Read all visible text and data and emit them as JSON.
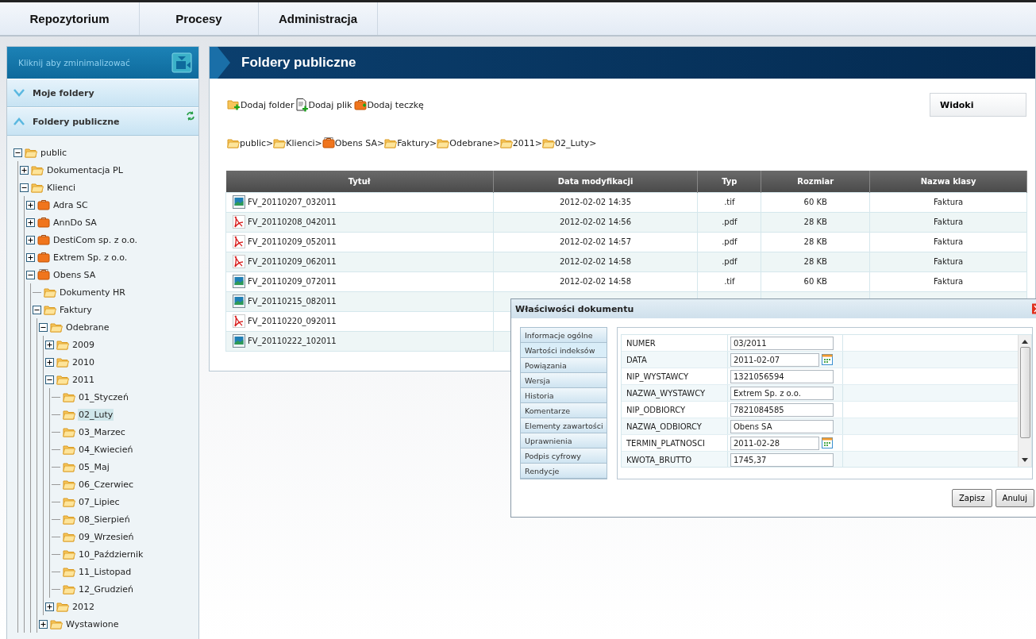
{
  "nav": {
    "items": [
      {
        "label": "Repozytorium",
        "selected": false
      },
      {
        "label": "Procesy",
        "selected": false
      },
      {
        "label": "Administracja",
        "selected": false
      }
    ]
  },
  "sidebar": {
    "minimize_label": "Kliknij aby zminimalizować",
    "sections": [
      {
        "label": "Moje foldery",
        "expanded": false
      },
      {
        "label": "Foldery publiczne",
        "expanded": true
      }
    ],
    "tree": [
      {
        "label": "public",
        "kind": "folder",
        "expanded": true,
        "selected": false,
        "children": [
          {
            "label": "Dokumentacja PL",
            "kind": "folder",
            "expanded": false,
            "selected": false
          },
          {
            "label": "Klienci",
            "kind": "folder",
            "expanded": true,
            "selected": false,
            "children": [
              {
                "label": "Adra SC",
                "kind": "case",
                "expanded": false,
                "selected": false
              },
              {
                "label": "AnnDo SA",
                "kind": "case",
                "expanded": false,
                "selected": false
              },
              {
                "label": "DestiCom sp. z o.o.",
                "kind": "case",
                "expanded": false,
                "selected": false
              },
              {
                "label": "Extrem Sp. z o.o.",
                "kind": "case",
                "expanded": false,
                "selected": false
              },
              {
                "label": "Obens SA",
                "kind": "opencase",
                "expanded": true,
                "selected": false,
                "children": [
                  {
                    "label": "Dokumenty HR",
                    "kind": "folder",
                    "selected": false
                  },
                  {
                    "label": "Faktury",
                    "kind": "folder",
                    "expanded": true,
                    "selected": false,
                    "children": [
                      {
                        "label": "Odebrane",
                        "kind": "folder",
                        "expanded": true,
                        "selected": false,
                        "children": [
                          {
                            "label": "2009",
                            "kind": "folder",
                            "expanded": false,
                            "selected": false
                          },
                          {
                            "label": "2010",
                            "kind": "folder",
                            "expanded": false,
                            "selected": false
                          },
                          {
                            "label": "2011",
                            "kind": "folder",
                            "expanded": true,
                            "selected": false,
                            "children": [
                              {
                                "label": "01_Styczeń",
                                "kind": "folder",
                                "selected": false
                              },
                              {
                                "label": "02_Luty",
                                "kind": "folder",
                                "selected": true
                              },
                              {
                                "label": "03_Marzec",
                                "kind": "folder",
                                "selected": false
                              },
                              {
                                "label": "04_Kwiecień",
                                "kind": "folder",
                                "selected": false
                              },
                              {
                                "label": "05_Maj",
                                "kind": "folder",
                                "selected": false
                              },
                              {
                                "label": "06_Czerwiec",
                                "kind": "folder",
                                "selected": false
                              },
                              {
                                "label": "07_Lipiec",
                                "kind": "folder",
                                "selected": false
                              },
                              {
                                "label": "08_Sierpień",
                                "kind": "folder",
                                "selected": false
                              },
                              {
                                "label": "09_Wrzesień",
                                "kind": "folder",
                                "selected": false
                              },
                              {
                                "label": "10_Październik",
                                "kind": "folder",
                                "selected": false
                              },
                              {
                                "label": "11_Listopad",
                                "kind": "folder",
                                "selected": false
                              },
                              {
                                "label": "12_Grudzień",
                                "kind": "folder",
                                "selected": false
                              }
                            ]
                          },
                          {
                            "label": "2012",
                            "kind": "folder",
                            "expanded": false,
                            "selected": false
                          }
                        ]
                      },
                      {
                        "label": "Wystawione",
                        "kind": "folder",
                        "expanded": false,
                        "selected": false
                      }
                    ]
                  }
                ]
              }
            ]
          }
        ]
      }
    ]
  },
  "main": {
    "title": "Foldery publiczne",
    "actions": [
      {
        "label": "Dodaj folder",
        "kind": "folder"
      },
      {
        "label": "Dodaj plik",
        "kind": "file"
      },
      {
        "label": "Dodaj teczkę",
        "kind": "case"
      }
    ],
    "views_button": "Widoki",
    "breadcrumb": [
      {
        "label": "public",
        "kind": "folder"
      },
      {
        "label": "Klienci",
        "kind": "folder"
      },
      {
        "label": "Obens SA",
        "kind": "opencase"
      },
      {
        "label": "Faktury",
        "kind": "folder"
      },
      {
        "label": "Odebrane",
        "kind": "folder"
      },
      {
        "label": "2011",
        "kind": "folder"
      },
      {
        "label": "02_Luty",
        "kind": "folder"
      }
    ],
    "breadcrumb_separator": ">",
    "table": {
      "columns": [
        "Tytuł",
        "Data modyfikacji",
        "Typ",
        "Rozmiar",
        "Nazwa klasy"
      ],
      "rows": [
        {
          "kind": "tif",
          "cells": [
            "FV_20110207_032011",
            "2012-02-02 14:35",
            ".tif",
            "60 KB",
            "Faktura"
          ]
        },
        {
          "kind": "pdf",
          "cells": [
            "FV_20110208_042011",
            "2012-02-02 14:56",
            ".pdf",
            "28 KB",
            "Faktura"
          ]
        },
        {
          "kind": "pdf",
          "cells": [
            "FV_20110209_052011",
            "2012-02-02 14:57",
            ".pdf",
            "28 KB",
            "Faktura"
          ]
        },
        {
          "kind": "pdf",
          "cells": [
            "FV_20110209_062011",
            "2012-02-02 14:58",
            ".pdf",
            "28 KB",
            "Faktura"
          ]
        },
        {
          "kind": "tif",
          "cells": [
            "FV_20110209_072011",
            "2012-02-02 14:58",
            ".tif",
            "60 KB",
            "Faktura"
          ]
        },
        {
          "kind": "tif",
          "cells": [
            "FV_20110215_082011"
          ]
        },
        {
          "kind": "pdf",
          "cells": [
            "FV_20110220_092011"
          ]
        },
        {
          "kind": "tif",
          "cells": [
            "FV_20110222_102011"
          ]
        }
      ]
    }
  },
  "dialog": {
    "title": "Właściwości dokumentu",
    "tabs": [
      {
        "label": "Informacje ogólne",
        "selected": false
      },
      {
        "label": "Wartości indeksów",
        "selected": true
      },
      {
        "label": "Powiązania",
        "selected": false
      },
      {
        "label": "Wersja",
        "selected": false
      },
      {
        "label": "Historia",
        "selected": false
      },
      {
        "label": "Komentarze",
        "selected": false
      },
      {
        "label": "Elementy zawartości",
        "selected": false
      },
      {
        "label": "Uprawnienia",
        "selected": false
      },
      {
        "label": "Podpis cyfrowy",
        "selected": false
      },
      {
        "label": "Rendycje",
        "selected": false
      }
    ],
    "fields": [
      {
        "label": "NUMER",
        "value": "03/2011",
        "kind": "text"
      },
      {
        "label": "DATA",
        "value": "2011-02-07",
        "kind": "date"
      },
      {
        "label": "NIP_WYSTAWCY",
        "value": "1321056594",
        "kind": "text"
      },
      {
        "label": "NAZWA_WYSTAWCY",
        "value": "Extrem Sp. z o.o.",
        "kind": "text"
      },
      {
        "label": "NIP_ODBIORCY",
        "value": "7821084585",
        "kind": "text"
      },
      {
        "label": "NAZWA_ODBIORCY",
        "value": "Obens SA",
        "kind": "text"
      },
      {
        "label": "TERMIN_PLATNOSCI",
        "value": "2011-02-28",
        "kind": "date"
      },
      {
        "label": "KWOTA_BRUTTO",
        "value": "1745,37",
        "kind": "text"
      }
    ],
    "buttons": [
      "Zapisz",
      "Anuluj"
    ]
  }
}
